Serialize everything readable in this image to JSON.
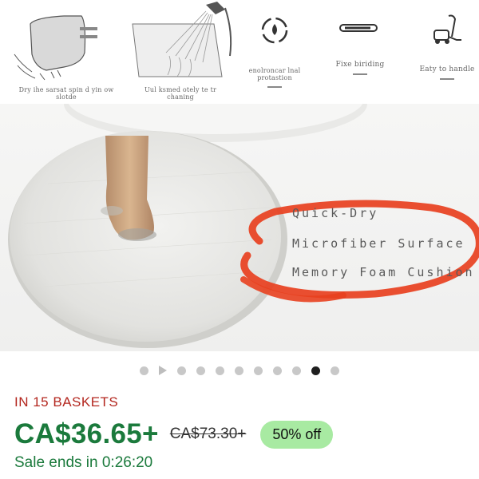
{
  "product_image": {
    "features": [
      {
        "caption": "Dry ihe sarsat spin d yin ow slotde"
      },
      {
        "caption": "Uul ksmed otely te tr chaning"
      },
      {
        "caption": "enolroncar lnal protastion"
      },
      {
        "caption": "Fixe biriding"
      },
      {
        "caption": "Eaty to handle"
      }
    ],
    "overlay_lines": [
      "Quick-Dry",
      "Microfiber Surface",
      "Memory Foam Cushion"
    ],
    "highlight_color": "#e8401f"
  },
  "carousel": {
    "total_dots": 10,
    "active_index": 9
  },
  "listing": {
    "baskets": "IN 15 BASKETS",
    "price": "CA$36.65+",
    "original_price": "CA$73.30+",
    "discount": "50% off",
    "sale_ends": "Sale ends in 0:26:20"
  }
}
